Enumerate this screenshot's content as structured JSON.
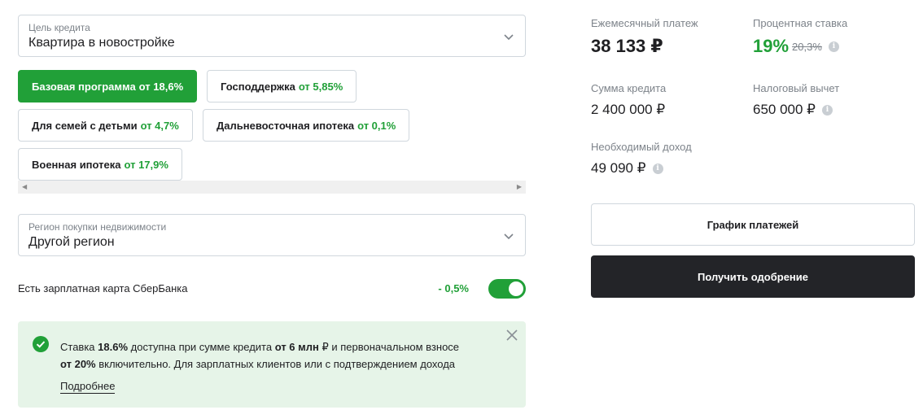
{
  "loan_purpose": {
    "label": "Цель кредита",
    "value": "Квартира в новостройке",
    "icon": "chevron-down-icon"
  },
  "programs": [
    {
      "name": "Базовая программа",
      "rate": "от 18,6%",
      "active": true
    },
    {
      "name": "Господдержка",
      "rate": "от 5,85%",
      "active": false
    },
    {
      "name": "Для семей с детьми",
      "rate": "от 4,7%",
      "active": false
    },
    {
      "name": "Дальневосточная ипотека",
      "rate": "от 0,1%",
      "active": false
    },
    {
      "name": "Военная ипотека",
      "rate": "от 17,9%",
      "active": false
    }
  ],
  "region": {
    "label": "Регион покупки недвижимости",
    "value": "Другой регион",
    "icon": "chevron-down-icon"
  },
  "salary_card": {
    "label": "Есть зарплатная карта СберБанка",
    "discount": "- 0,5%",
    "enabled": true
  },
  "notice": {
    "t1": "Ставка ",
    "b1": "18.6%",
    "t2": " доступна при сумме кредита ",
    "b2": "от 6 млн",
    "t3": " ₽ и первоначальном взносе",
    "b3": "от 20%",
    "t4": " включительно. Для зарплатных клиентов или с подтверждением дохода",
    "more": "Подробнее",
    "icon": "check-circle-icon",
    "close_icon": "close-icon"
  },
  "summary": {
    "monthly_payment": {
      "title": "Ежемесячный платеж",
      "value": "38 133 ₽"
    },
    "interest_rate": {
      "title": "Процентная ставка",
      "value": "19%",
      "old_value": "20,3%"
    },
    "loan_amount": {
      "title": "Сумма кредита",
      "value": "2 400 000 ₽"
    },
    "tax_deduction": {
      "title": "Налоговый вычет",
      "value": "650 000 ₽"
    },
    "required_income": {
      "title": "Необходимый доход",
      "value": "49 090 ₽"
    },
    "info_icon": "info-icon"
  },
  "buttons": {
    "schedule": "График платежей",
    "approval": "Получить одобрение"
  },
  "colors": {
    "accent": "#21a038",
    "dark": "#232428",
    "notice_bg": "#e6f4e8"
  }
}
